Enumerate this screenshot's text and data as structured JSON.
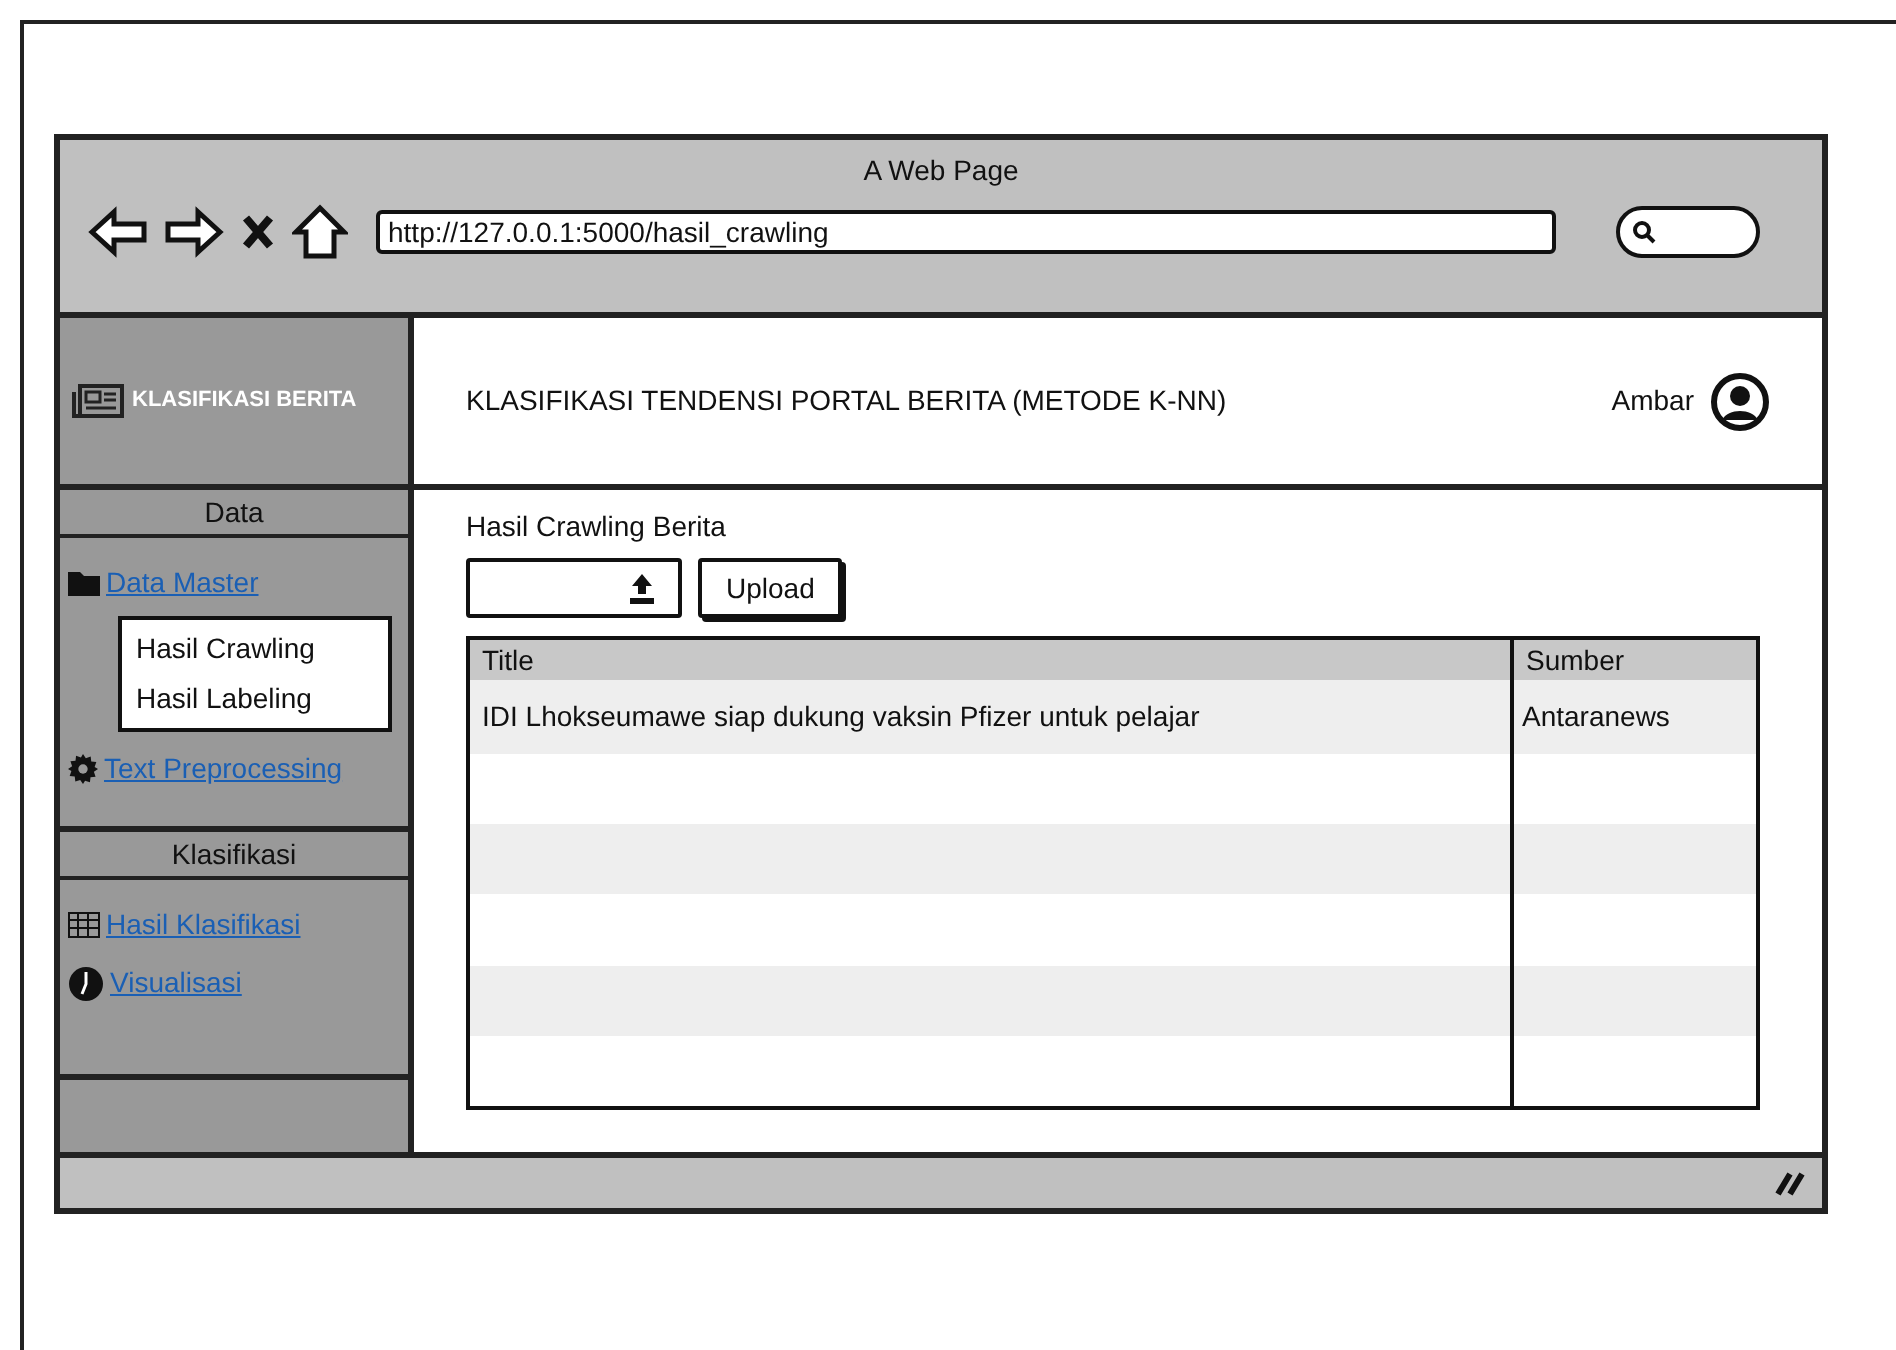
{
  "browser": {
    "title": "A Web Page",
    "url": "http://127.0.0.1:5000/hasil_crawling"
  },
  "sidebar": {
    "brand": "KLASIFIKASI BERITA",
    "sections": [
      {
        "title": "Data",
        "items": [
          {
            "kind": "folder",
            "label": "Data Master",
            "children": [
              {
                "label": "Hasil Crawling"
              },
              {
                "label": "Hasil Labeling"
              }
            ]
          },
          {
            "kind": "gear",
            "label": "Text Preprocessing"
          }
        ]
      },
      {
        "title": "Klasifikasi",
        "items": [
          {
            "kind": "table",
            "label": "Hasil Klasifikasi"
          },
          {
            "kind": "chart",
            "label": "Visualisasi"
          }
        ]
      }
    ]
  },
  "header": {
    "title": "KLASIFIKASI TENDENSI PORTAL BERITA (METODE K-NN)",
    "user": "Ambar"
  },
  "content": {
    "heading": "Hasil Crawling Berita",
    "upload_button": "Upload",
    "table": {
      "columns": [
        "Title",
        "Sumber"
      ],
      "rows": [
        [
          "IDI Lhokseumawe siap dukung vaksin Pfizer untuk pelajar",
          "Antaranews"
        ]
      ]
    }
  }
}
